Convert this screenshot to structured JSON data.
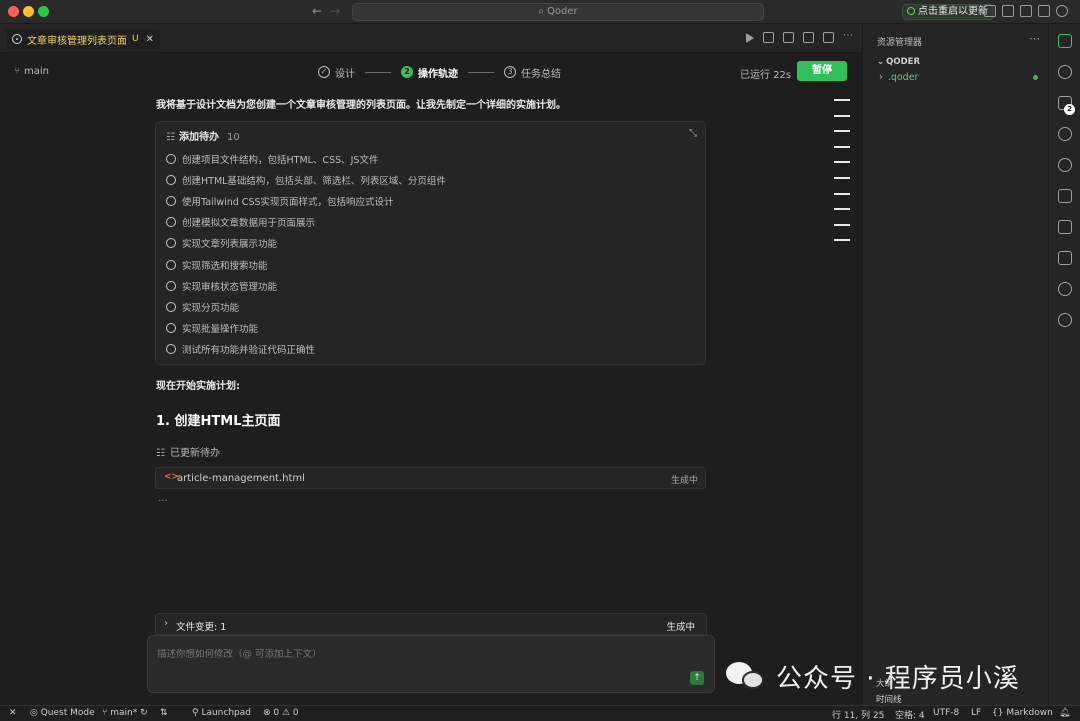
{
  "window": {
    "search_label": "Qoder",
    "update_label": "点击重启以更新"
  },
  "tab": {
    "title": "文章审核管理列表页面",
    "modified_marker": "U"
  },
  "editor": {
    "branch": "main",
    "steps": [
      {
        "label": "设计",
        "state": "done"
      },
      {
        "label": "操作轨迹",
        "state": "active",
        "number": "2"
      },
      {
        "label": "任务总结",
        "state": "pending",
        "number": "3"
      }
    ],
    "elapsed": "已运行 22s",
    "pause_label": "暂停",
    "intro_text": "我将基于设计文档为您创建一个文章审核管理的列表页面。让我先制定一个详细的实施计划。",
    "todo": {
      "title": "添加待办",
      "count": "10",
      "items": [
        "创建项目文件结构，包括HTML、CSS、JS文件",
        "创建HTML基础结构，包括头部、筛选栏、列表区域、分页组件",
        "使用Tailwind CSS实现页面样式，包括响应式设计",
        "创建模拟文章数据用于页面展示",
        "实现文章列表展示功能",
        "实现筛选和搜索功能",
        "实现审核状态管理功能",
        "实现分页功能",
        "实现批量操作功能",
        "测试所有功能并验证代码正确性"
      ]
    },
    "impl_start": "现在开始实施计划:",
    "section_title": "1. 创建HTML主页面",
    "updated_label": "已更新待办",
    "file": {
      "name": "article-management.html",
      "status": "生成中"
    },
    "ellipsis": "...",
    "changes": {
      "label": "文件变更: 1",
      "status": "生成中"
    },
    "input_placeholder": "描述你想如何修改（@ 可添加上下文）"
  },
  "explorer": {
    "title": "资源管理器",
    "section": "QODER",
    "items": [
      {
        "name": ".qoder"
      }
    ]
  },
  "activity": {
    "scm_badge": "2"
  },
  "outline": {
    "outline_label": "大纲",
    "timeline_label": "时间线"
  },
  "statusbar": {
    "mode": "Quest Mode",
    "branch": "main*",
    "launchpad": "Launchpad",
    "problems": "⊗ 0 ⚠ 0",
    "position": "行 11, 列 25",
    "spaces": "空格: 4",
    "encoding": "UTF-8",
    "eol": "LF",
    "language": "Markdown"
  },
  "watermark": {
    "text": "公众号 · 程序员小溪"
  }
}
